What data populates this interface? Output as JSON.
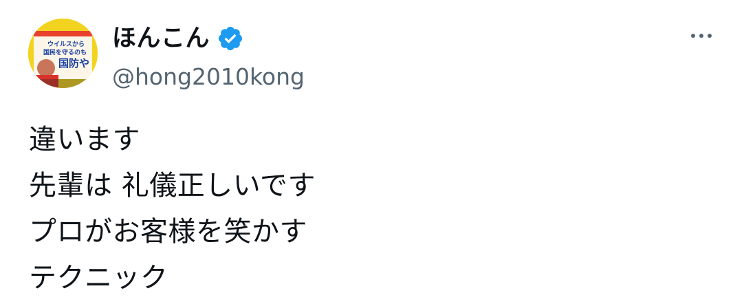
{
  "author": {
    "display_name": "ほんこん",
    "handle": "@hong2010kong",
    "verified": true,
    "avatar_caption": "ウイルスから国民を守るのも国防や"
  },
  "menu": {
    "more_icon": "more-horizontal-icon"
  },
  "tweet": {
    "lines": [
      "違います",
      "先輩は 礼儀正しいです",
      "プロがお客様を笑かす",
      "テクニック"
    ]
  },
  "colors": {
    "text_primary": "#0f1419",
    "text_secondary": "#536471",
    "verified_blue": "#1d9bf0",
    "background": "#ffffff"
  }
}
